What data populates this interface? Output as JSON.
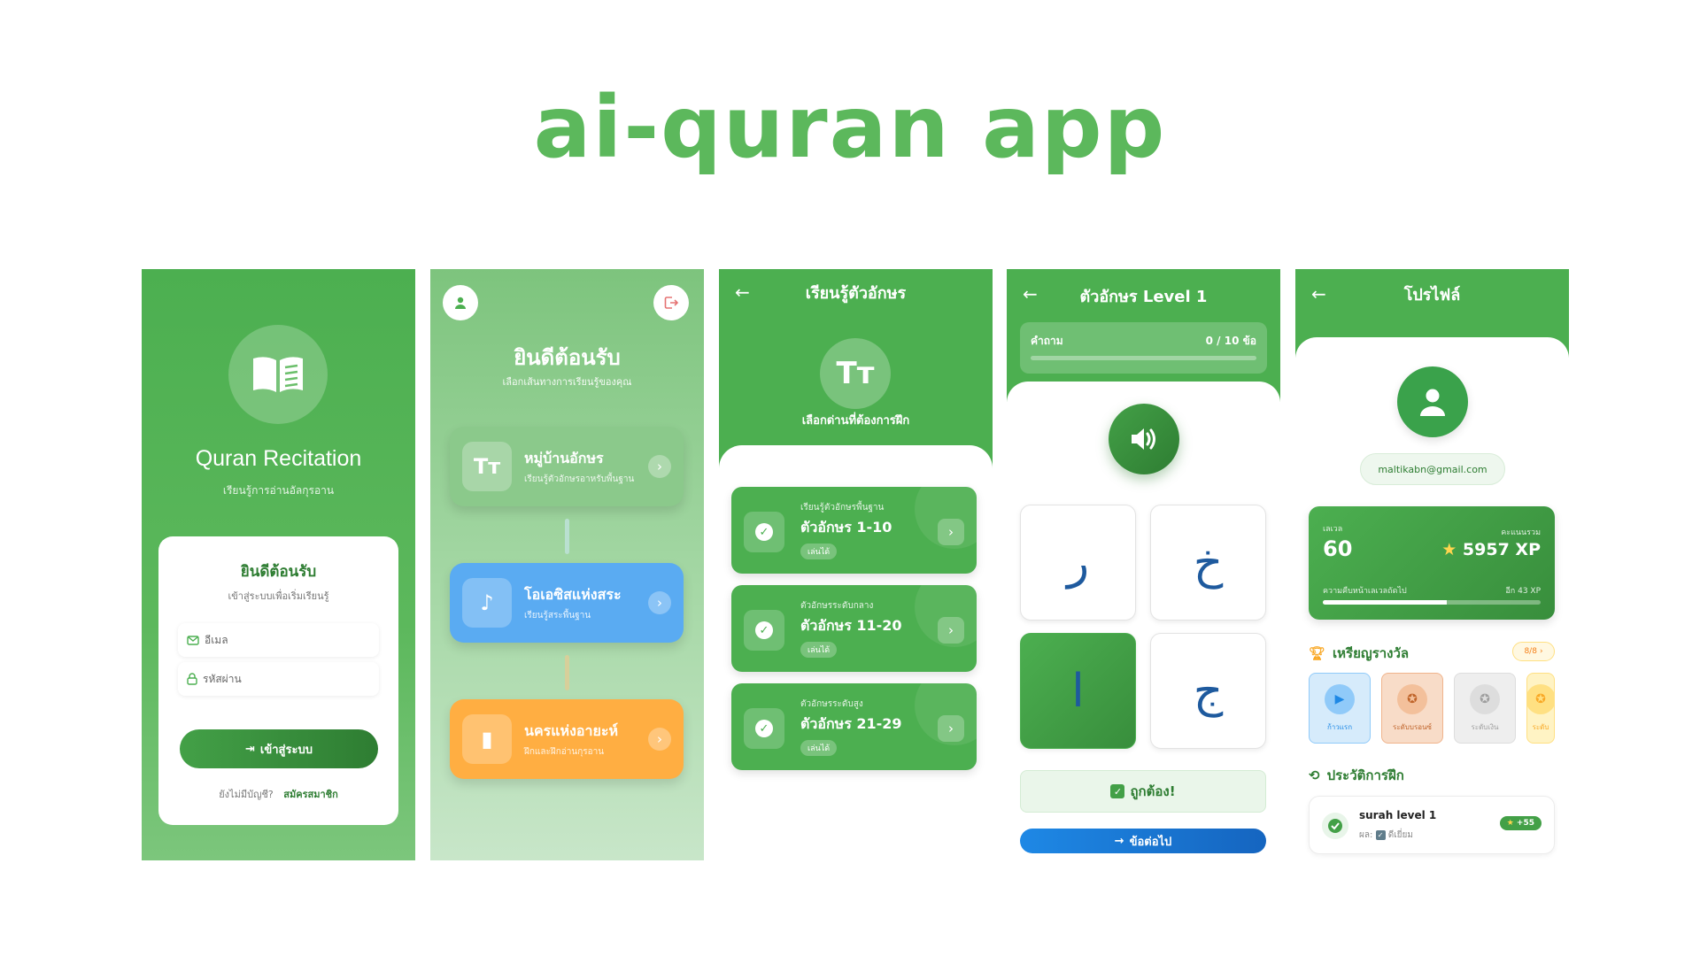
{
  "title": "ai-quran app",
  "screen1": {
    "app_title": "Quran Recitation",
    "subtitle": "เรียนรู้การอ่านอัลกุรอาน",
    "card_title": "ยินดีต้อนรับ",
    "card_subtitle": "เข้าสู่ระบบเพื่อเริ่มเรียนรู้",
    "email_placeholder": "อีเมล",
    "password_placeholder": "รหัสผ่าน",
    "login_label": "เข้าสู่ระบบ",
    "no_account": "ยังไม่มีบัญชี?",
    "register": "สมัครสมาชิก"
  },
  "screen2": {
    "title": "ยินดีต้อนรับ",
    "subtitle": "เลือกเส้นทางการเรียนรู้ของคุณ",
    "cards": [
      {
        "icon": "Tт",
        "title": "หมู่บ้านอักษร",
        "desc": "เรียนรู้ตัวอักษรอาหรับพื้นฐาน",
        "color": "#8bc98b"
      },
      {
        "icon": "♪",
        "title": "โอเอซิสแห่งสระ",
        "desc": "เรียนรู้สระพื้นฐาน",
        "color": "#5aabf2"
      },
      {
        "icon": "▮",
        "title": "นครแห่งอายะห์",
        "desc": "ฝึกและฝึกอ่านกุรอาน",
        "color": "#ffae42"
      }
    ]
  },
  "screen3": {
    "title": "เรียนรู้ตัวอักษร",
    "icon": "Tт",
    "prompt": "เลือกด่านที่ต้องการฝึก",
    "levels": [
      {
        "level": "เรียนรู้ตัวอักษรพื้นฐาน",
        "name": "ตัวอักษร 1-10",
        "tag": "เล่นได้"
      },
      {
        "level": "ตัวอักษรระดับกลาง",
        "name": "ตัวอักษร 11-20",
        "tag": "เล่นได้"
      },
      {
        "level": "ตัวอักษรระดับสูง",
        "name": "ตัวอักษร 21-29",
        "tag": "เล่นได้"
      }
    ]
  },
  "screen4": {
    "title": "ตัวอักษร Level 1",
    "progress_label": "คำถาม",
    "progress_count": "0 / 10 ข้อ",
    "progress": 0,
    "options": [
      "ر",
      "خ",
      "ا",
      "ج"
    ],
    "selected_index": 2,
    "feedback": "ถูกต้อง!",
    "next_label": "ข้อต่อไป"
  },
  "screen5": {
    "title": "โปรไฟล์",
    "email": "maltikabn@gmail.com",
    "level_label": "เลเวล",
    "level_value": "60",
    "score_label": "คะแนนรวม",
    "score_value": "5957 XP",
    "progress_label": "ความคืบหน้าเลเวลถัดไป",
    "remaining": "อีก 43 XP",
    "level_progress": 0.57,
    "medals_title": "เหรียญรางวัล",
    "medals_count": "8/8",
    "medals": [
      {
        "label": "ก้าวแรก",
        "bg": "#d6ebfb",
        "border": "#90caf9",
        "circle": "#90caf9",
        "fg": "#1e88e5",
        "icon": "▶"
      },
      {
        "label": "ระดับบรอนซ์",
        "bg": "#f8dcc8",
        "border": "#f0b48c",
        "circle": "#f3c09b",
        "fg": "#c0642a",
        "icon": "✪"
      },
      {
        "label": "ระดับเงิน",
        "bg": "#eeeeee",
        "border": "#dddddd",
        "circle": "#dddddd",
        "fg": "#9e9e9e",
        "icon": "✪"
      },
      {
        "label": "ระดับ",
        "bg": "#fff3c4",
        "border": "#ffe082",
        "circle": "#ffe082",
        "fg": "#f9a825",
        "icon": "✪"
      }
    ],
    "history_title": "ประวัติการฝึก",
    "history": {
      "name": "surah level 1",
      "result_label": "ผล:",
      "result": "ดีเยี่ยม",
      "xp": "+55"
    }
  }
}
